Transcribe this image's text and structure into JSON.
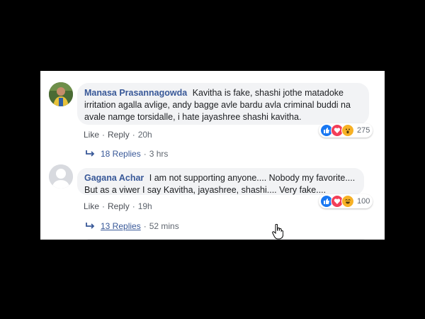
{
  "comments": [
    {
      "author": "Manasa Prasannagowda",
      "text": "Kavitha is fake, shashi jothe matadoke irritation agalla avlige, andy bagge avle bardu avla criminal buddi na avale namge torsidalle, i hate jayashree shashi kavitha.",
      "like_label": "Like",
      "reply_label": "Reply",
      "time": "20h",
      "reaction_count": "275",
      "reactions": [
        "like-icon",
        "love-icon",
        "wow-icon"
      ],
      "replies_label": "18 Replies",
      "replies_time": "3 hrs"
    },
    {
      "author": "Gagana Achar",
      "text": "I am not supporting anyone.... Nobody my favorite.... But as a viwer I say Kavitha, jayashree, shashi.... Very fake....",
      "like_label": "Like",
      "reply_label": "Reply",
      "time": "19h",
      "reaction_count": "100",
      "reactions": [
        "like-icon",
        "love-icon",
        "haha-icon"
      ],
      "replies_label": "13 Replies",
      "replies_time": "52 mins"
    }
  ],
  "dot": "·",
  "colors": {
    "name_blue": "#385898",
    "bubble_bg": "#f2f3f5",
    "like_blue": "#1877f2",
    "love_red": "#f33e58",
    "wow_yellow": "#f7b125"
  }
}
